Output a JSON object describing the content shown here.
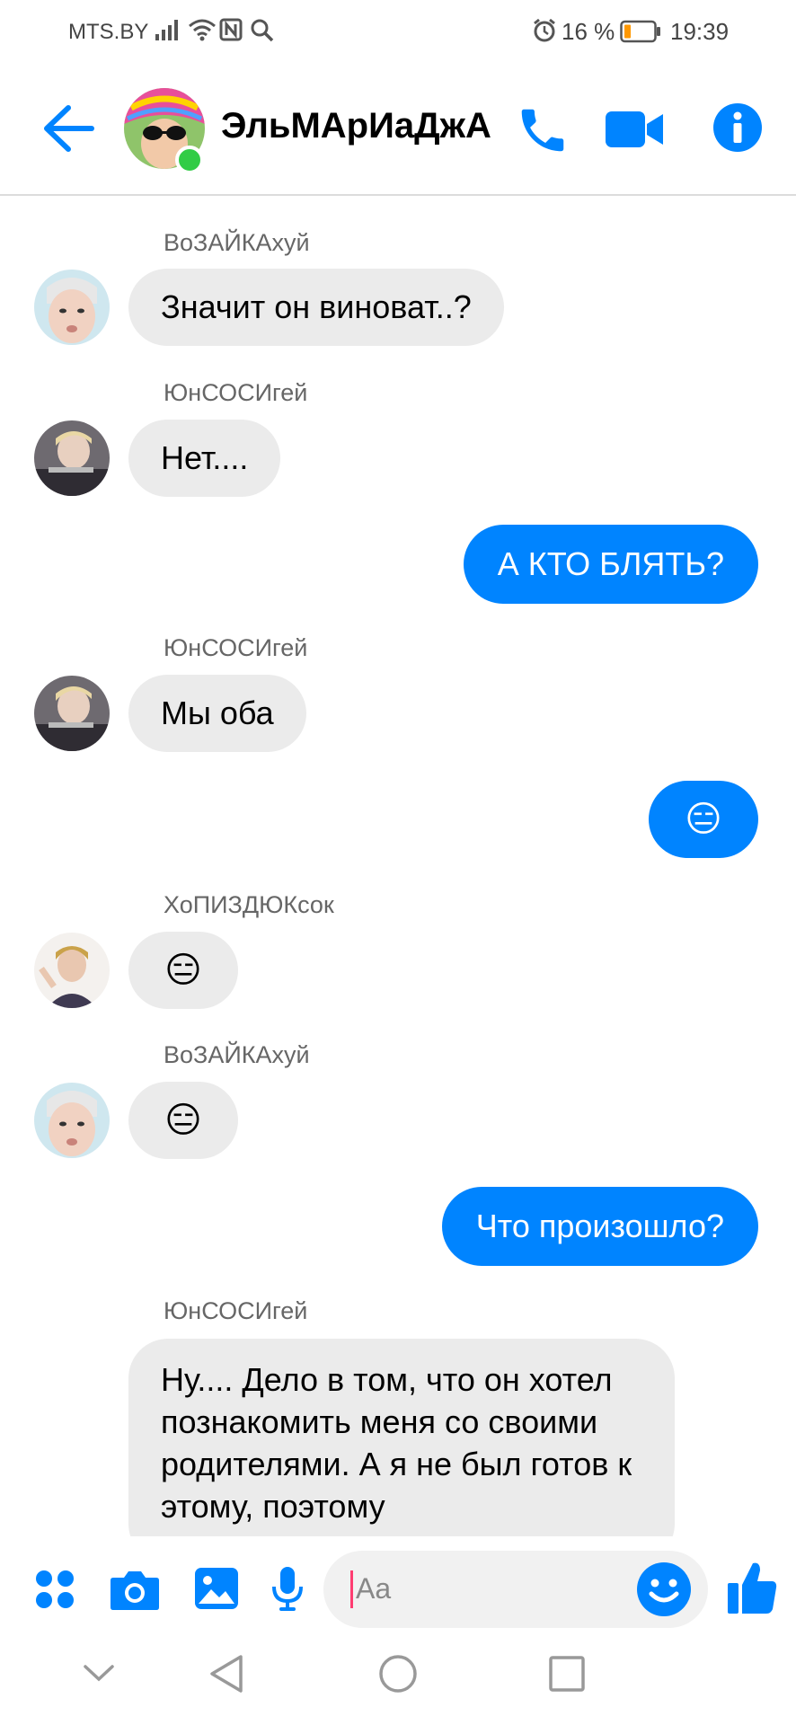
{
  "status_bar": {
    "carrier": "MTS.BY",
    "battery_pct": "16 %",
    "time": "19:39",
    "icons": [
      "signal-icon",
      "wifi-icon",
      "nfc-icon",
      "search-icon",
      "alarm-icon",
      "battery-icon"
    ]
  },
  "header": {
    "title": "ЭльМАрИаДжА",
    "accent_color": "#0084ff",
    "online_color": "#31cc46",
    "icons": [
      "back-arrow-icon",
      "phone-icon",
      "video-camera-icon",
      "info-icon"
    ]
  },
  "messages": [
    {
      "sender": "ВоЗАЙКАхуй",
      "text": "Значит он виноват..?"
    },
    {
      "sender": "ЮнСОСИгей",
      "text": "Нет...."
    },
    {
      "outgoing": true,
      "text": "А КТО БЛЯТЬ?"
    },
    {
      "sender": "ЮнСОСИгей",
      "text": "Мы оба"
    },
    {
      "outgoing": true,
      "text": "😑"
    },
    {
      "sender": "ХоПИЗДЮКсок",
      "text": "😑"
    },
    {
      "sender": "ВоЗАЙКАхуй",
      "text": "😑"
    },
    {
      "outgoing": true,
      "text": "Что произошло?"
    },
    {
      "sender": "ЮнСОСИгей",
      "text": "Ну.... Дело в том, что он хотел познакомить меня со своими родителями. А я не был готов к этому, поэтому"
    }
  ],
  "composer": {
    "placeholder": "Aa",
    "icons": [
      "apps-icon",
      "camera-icon",
      "gallery-icon",
      "microphone-icon",
      "emoji-icon",
      "like-icon"
    ]
  },
  "nav_bar": {
    "icons": [
      "chevron-down-icon",
      "back-triangle-icon",
      "home-circle-icon",
      "recents-square-icon"
    ]
  }
}
